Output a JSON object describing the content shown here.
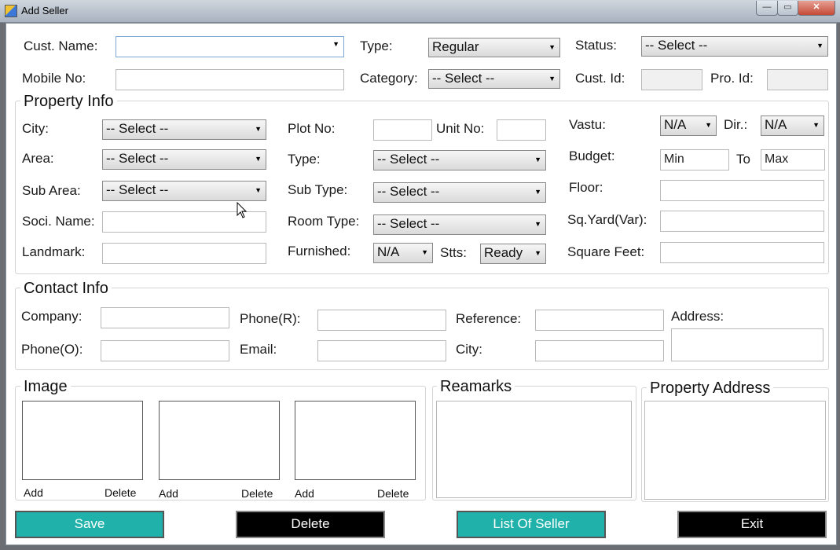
{
  "window": {
    "title": "Add Seller",
    "min_glyph": "—",
    "max_glyph": "▭",
    "close_glyph": "✕"
  },
  "header": {
    "cust_name_label": "Cust. Name:",
    "cust_name_value": "",
    "type_label": "Type:",
    "type_value": "Regular",
    "status_label": "Status:",
    "status_value": "-- Select --",
    "mobile_label": "Mobile No:",
    "mobile_value": "",
    "category_label": "Category:",
    "category_value": "-- Select --",
    "cust_id_label": "Cust. Id:",
    "cust_id_value": "",
    "pro_id_label": "Pro. Id:",
    "pro_id_value": ""
  },
  "property": {
    "title": "Property Info",
    "city_label": "City:",
    "city_value": "-- Select --",
    "area_label": "Area:",
    "area_value": "-- Select --",
    "subarea_label": "Sub Area:",
    "subarea_value": "-- Select --",
    "soci_label": "Soci. Name:",
    "soci_value": "",
    "landmark_label": "Landmark:",
    "landmark_value": "",
    "plot_label": "Plot No:",
    "plot_value": "",
    "unit_label": "Unit No:",
    "unit_value": "",
    "ptype_label": "Type:",
    "ptype_value": "-- Select --",
    "subtype_label": "Sub Type:",
    "subtype_value": "-- Select --",
    "roomtype_label": "Room Type:",
    "roomtype_value": "-- Select --",
    "furnished_label": "Furnished:",
    "furnished_value": "N/A",
    "stts_label": "Stts:",
    "stts_value": "Ready",
    "vastu_label": "Vastu:",
    "vastu_value": "N/A",
    "dir_label": "Dir.:",
    "dir_value": "N/A",
    "budget_label": "Budget:",
    "budget_min": "Min",
    "budget_to": "To",
    "budget_max": "Max",
    "floor_label": "Floor:",
    "floor_value": "",
    "sqyard_label": "Sq.Yard(Var):",
    "sqyard_value": "",
    "sqfeet_label": "Square Feet:",
    "sqfeet_value": ""
  },
  "contact": {
    "title": "Contact Info",
    "company_label": "Company:",
    "company_value": "",
    "phone_o_label": "Phone(O):",
    "phone_o_value": "",
    "phone_r_label": "Phone(R):",
    "phone_r_value": "",
    "email_label": "Email:",
    "email_value": "",
    "reference_label": "Reference:",
    "reference_value": "",
    "city_label": "City:",
    "city_value": "",
    "address_label": "Address:",
    "address_value": ""
  },
  "image": {
    "title": "Image",
    "add_label": "Add",
    "delete_label": "Delete"
  },
  "remarks": {
    "title": "Reamarks",
    "value": ""
  },
  "prop_address": {
    "title": "Property Address",
    "value": ""
  },
  "buttons": {
    "save": "Save",
    "delete": "Delete",
    "list": "List Of Seller",
    "exit": "Exit"
  },
  "icons": {
    "dropdown": "▼"
  },
  "colors": {
    "accent_teal": "#20b2aa",
    "black_button": "#000000"
  }
}
